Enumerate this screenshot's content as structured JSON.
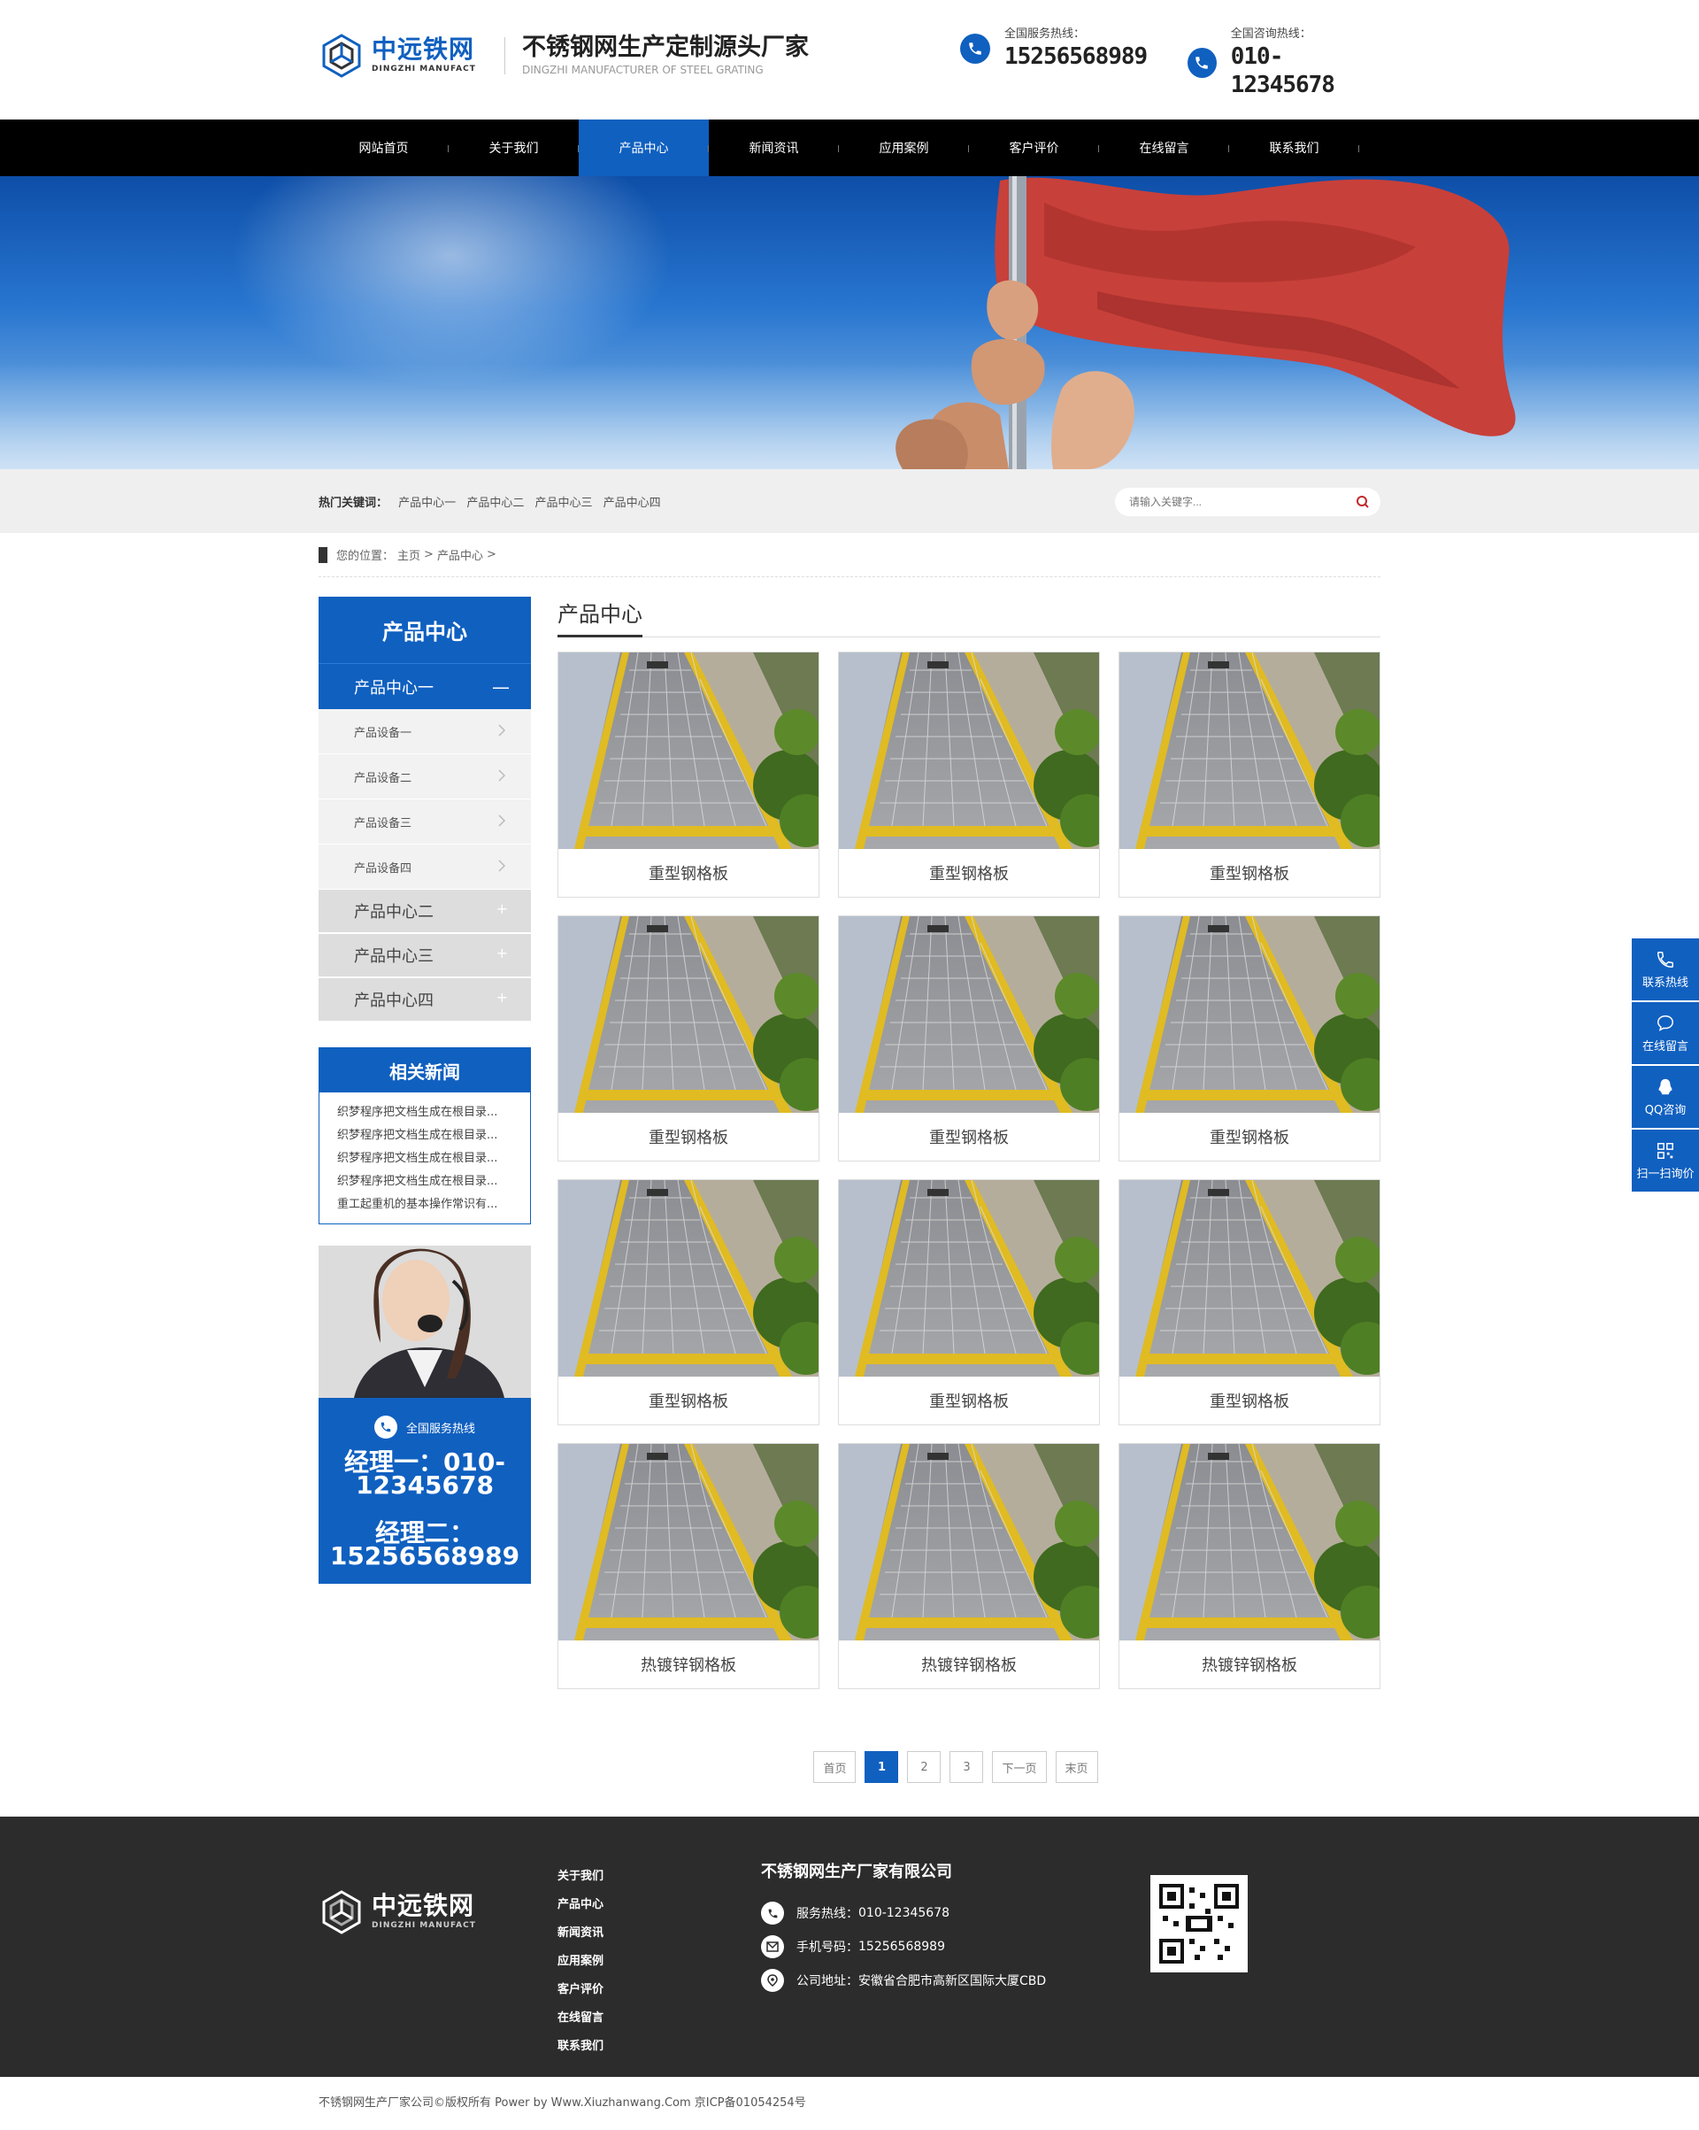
{
  "header": {
    "logo_name": "中远铁网",
    "logo_sub": "DINGZHI MANUFACT",
    "slogan": "不锈钢网生产定制源头厂家",
    "slogan_sub": "DINGZHI MANUFACTURER OF STEEL GRATING",
    "hotlines": [
      {
        "label": "全国服务热线：",
        "number": "15256568989"
      },
      {
        "label": "全国咨询热线：",
        "number": "010-12345678"
      }
    ]
  },
  "nav": {
    "items": [
      "网站首页",
      "关于我们",
      "产品中心",
      "新闻资讯",
      "应用案例",
      "客户评价",
      "在线留言",
      "联系我们"
    ],
    "active_index": 2
  },
  "search": {
    "hot_label": "热门关键词：",
    "keywords": [
      "产品中心一",
      "产品中心二",
      "产品中心三",
      "产品中心四"
    ],
    "placeholder": "请输入关键字..."
  },
  "breadcrumb": {
    "label": "您的位置：",
    "home": "主页",
    "sep": ">",
    "current": "产品中心"
  },
  "sidebar": {
    "title": "产品中心",
    "open_category": "产品中心一",
    "open_sign": "—",
    "sub_items": [
      "产品设备一",
      "产品设备二",
      "产品设备三",
      "产品设备四"
    ],
    "closed_categories": [
      "产品中心二",
      "产品中心三",
      "产品中心四"
    ],
    "closed_sign": "+",
    "news_title": "相关新闻",
    "news": [
      "织梦程序把文档生成在根目录...",
      "织梦程序把文档生成在根目录...",
      "织梦程序把文档生成在根目录...",
      "织梦程序把文档生成在根目录...",
      "重工起重机的基本操作常识有..."
    ],
    "contact_label": "全国服务热线",
    "manager1": "经理一：010-12345678",
    "manager2": "经理二：15256568989"
  },
  "main": {
    "title": "产品中心",
    "products": [
      "重型钢格板",
      "重型钢格板",
      "重型钢格板",
      "重型钢格板",
      "重型钢格板",
      "重型钢格板",
      "重型钢格板",
      "重型钢格板",
      "重型钢格板",
      "热镀锌钢格板",
      "热镀锌钢格板",
      "热镀锌钢格板"
    ]
  },
  "pager": {
    "first": "首页",
    "pages": [
      "1",
      "2",
      "3"
    ],
    "current": "1",
    "next": "下一页",
    "last": "末页"
  },
  "footer": {
    "logo_name": "中远铁网",
    "logo_sub": "DINGZHI MANUFACT",
    "links": [
      "关于我们",
      "产品中心",
      "新闻资讯",
      "应用案例",
      "客户评价",
      "在线留言",
      "联系我们"
    ],
    "company": "不锈钢网生产厂家有限公司",
    "rows": [
      {
        "label": "服务热线：",
        "value": "010-12345678"
      },
      {
        "label": "手机号码：",
        "value": "15256568989"
      },
      {
        "label": "公司地址：",
        "value": "安徽省合肥市高新区国际大厦CBD"
      }
    ],
    "copyright": "不锈钢网生产厂家公司©版权所有 Power by Www.Xiuzhanwang.Com 京ICP备01054254号"
  },
  "float_bar": [
    "联系热线",
    "在线留言",
    "QQ咨询",
    "扫一扫询价"
  ],
  "colors": {
    "brand": "#1060c0",
    "nav_bg": "#000000",
    "footer_bg": "#2c2c2c"
  }
}
